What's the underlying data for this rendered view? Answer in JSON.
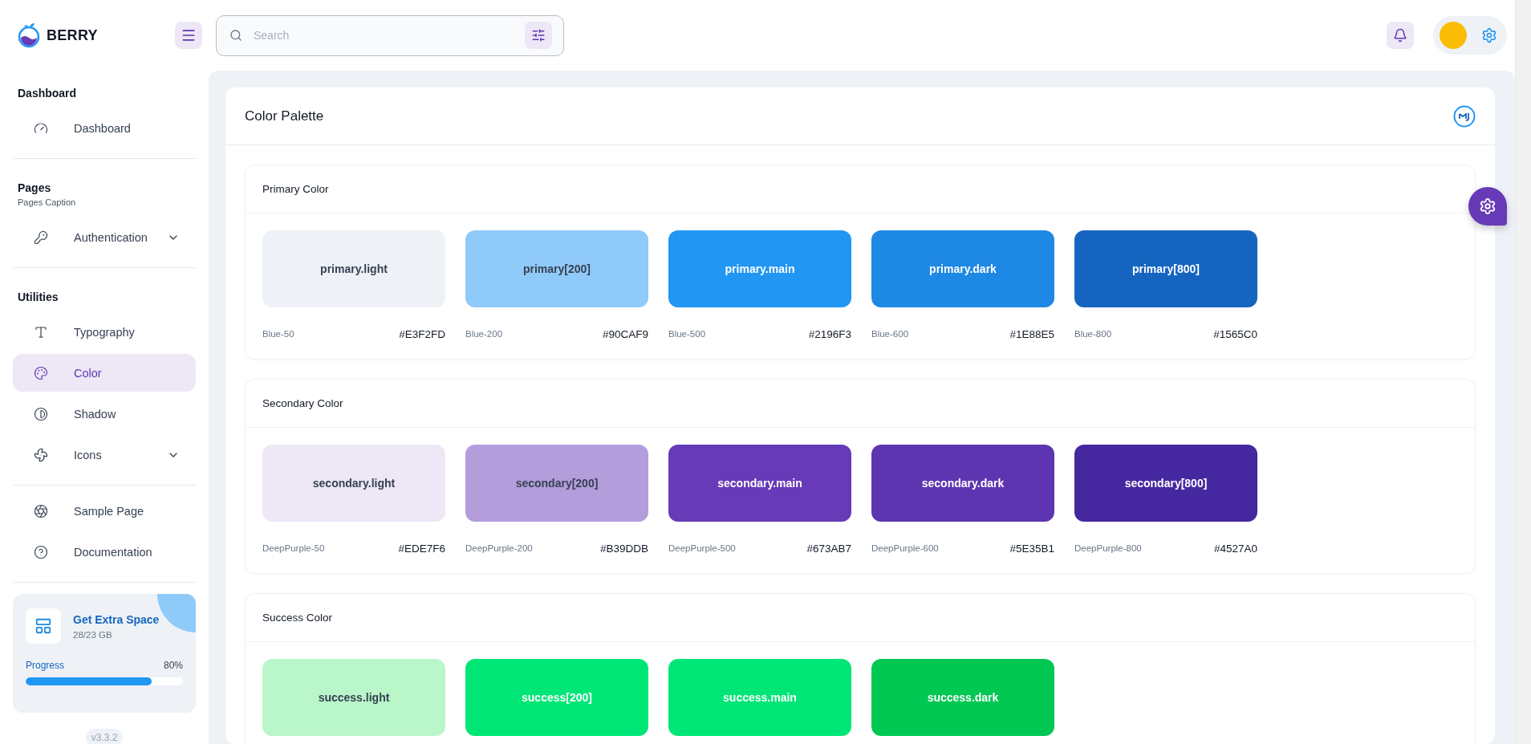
{
  "brand": "BERRY",
  "search": {
    "placeholder": "Search"
  },
  "sidebar": {
    "groups": [
      {
        "title": "Dashboard",
        "items": [
          {
            "label": "Dashboard",
            "selected": false
          }
        ]
      },
      {
        "title": "Pages",
        "caption": "Pages Caption",
        "items": [
          {
            "label": "Authentication",
            "selected": false,
            "expanded": false
          }
        ]
      },
      {
        "title": "Utilities",
        "items": [
          {
            "label": "Typography",
            "selected": false
          },
          {
            "label": "Color",
            "selected": true
          },
          {
            "label": "Shadow",
            "selected": false
          },
          {
            "label": "Icons",
            "selected": false,
            "expanded": false
          }
        ]
      },
      {
        "items": [
          {
            "label": "Sample Page",
            "selected": false
          },
          {
            "label": "Documentation",
            "selected": false
          }
        ]
      }
    ],
    "upgrade": {
      "title": "Get Extra Space",
      "usage": "28/23 GB",
      "progress_label": "Progress",
      "progress_reading": "80%",
      "level": 0.8
    },
    "version": "v3.3.2"
  },
  "page": {
    "title": "Color Palette",
    "sections": [
      {
        "title": "Primary Color",
        "swatches": [
          {
            "name": "primary.light",
            "shade": "Blue-50",
            "hex": "#E3F2FD",
            "color": "#eef2f6"
          },
          {
            "name": "primary[200]",
            "shade": "Blue-200",
            "hex": "#90CAF9",
            "color": "#90caf9"
          },
          {
            "name": "primary.main",
            "shade": "Blue-500",
            "hex": "#2196F3",
            "color": "#2196f3"
          },
          {
            "name": "primary.dark",
            "shade": "Blue-600",
            "hex": "#1E88E5",
            "color": "#1e88e5"
          },
          {
            "name": "primary[800]",
            "shade": "Blue-800",
            "hex": "#1565C0",
            "color": "#1565c0"
          }
        ]
      },
      {
        "title": "Secondary Color",
        "swatches": [
          {
            "name": "secondary.light",
            "shade": "DeepPurple-50",
            "hex": "#EDE7F6",
            "color": "#ede7f6"
          },
          {
            "name": "secondary[200]",
            "shade": "DeepPurple-200",
            "hex": "#B39DDB",
            "color": "#b39ddb"
          },
          {
            "name": "secondary.main",
            "shade": "DeepPurple-500",
            "hex": "#673AB7",
            "color": "#673ab7"
          },
          {
            "name": "secondary.dark",
            "shade": "DeepPurple-600",
            "hex": "#5E35B1",
            "color": "#5e35b1"
          },
          {
            "name": "secondary[800]",
            "shade": "DeepPurple-800",
            "hex": "#4527A0",
            "color": "#4527a0"
          }
        ]
      },
      {
        "title": "Success Color",
        "swatches": [
          {
            "name": "success.light",
            "color": "#b9f6ca"
          },
          {
            "name": "success[200]",
            "color": "#00e676"
          },
          {
            "name": "success.main",
            "color": "#00e676"
          },
          {
            "name": "success.dark",
            "color": "#00c853"
          }
        ]
      }
    ]
  }
}
